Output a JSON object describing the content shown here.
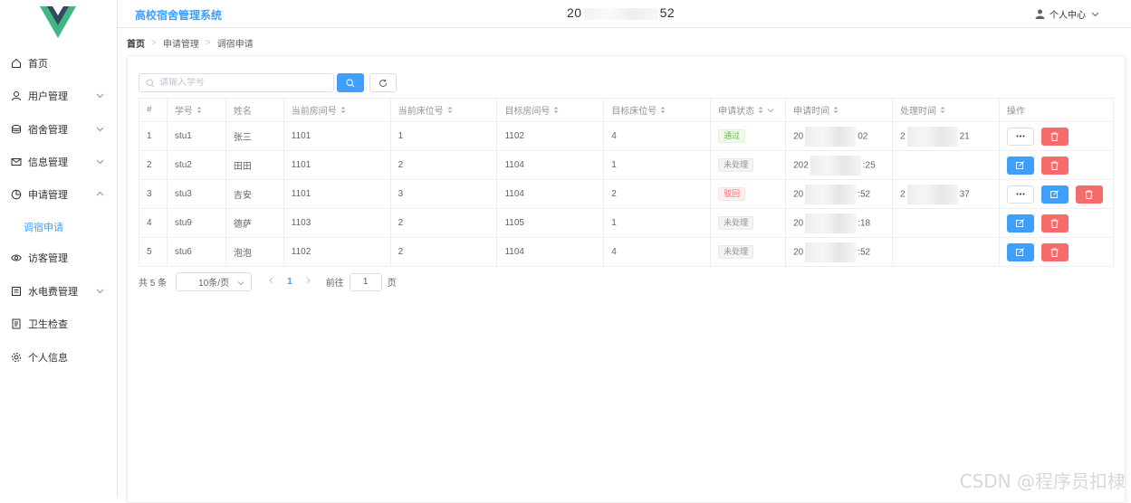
{
  "app": {
    "title": "高校宿舍管理系统"
  },
  "header": {
    "clock_prefix": "20",
    "clock_suffix": "52",
    "user_menu_label": "个人中心"
  },
  "sidebar": {
    "items": [
      {
        "label": "首页",
        "icon": "home-icon"
      },
      {
        "label": "用户管理",
        "icon": "user-icon"
      },
      {
        "label": "宿舍管理",
        "icon": "coin-icon"
      },
      {
        "label": "信息管理",
        "icon": "message-icon"
      },
      {
        "label": "申请管理",
        "icon": "pie-chart-icon"
      },
      {
        "label": "调宿申请",
        "icon": ""
      },
      {
        "label": "访客管理",
        "icon": "view-icon"
      },
      {
        "label": "水电费管理",
        "icon": "tickets-icon"
      },
      {
        "label": "卫生检查",
        "icon": "document-icon"
      },
      {
        "label": "个人信息",
        "icon": "setting-icon"
      }
    ]
  },
  "breadcrumb": {
    "home": "首页",
    "level2": "申请管理",
    "level3": "调宿申请"
  },
  "search": {
    "placeholder": "请输入学号",
    "value": ""
  },
  "table": {
    "headers": [
      "#",
      "学号",
      "姓名",
      "当前房间号",
      "当前床位号",
      "目标房间号",
      "目标床位号",
      "申请状态",
      "申请时间",
      "处理时间",
      "操作"
    ],
    "rows": [
      {
        "idx": "1",
        "student_id": "stu1",
        "name": "张三",
        "cur_room": "1101",
        "cur_bed": "1",
        "target_room": "1102",
        "target_bed": "4",
        "status": "通过",
        "status_type": "success",
        "apply_time_prefix": "20",
        "apply_time_suffix": "02",
        "handle_time_prefix": "2",
        "handle_time_suffix": "21"
      },
      {
        "idx": "2",
        "student_id": "stu2",
        "name": "田田",
        "cur_room": "1101",
        "cur_bed": "2",
        "target_room": "1104",
        "target_bed": "1",
        "status": "未处理",
        "status_type": "info",
        "apply_time_prefix": "202",
        "apply_time_suffix": ":25",
        "handle_time_prefix": "",
        "handle_time_suffix": ""
      },
      {
        "idx": "3",
        "student_id": "stu3",
        "name": "吉安",
        "cur_room": "1101",
        "cur_bed": "3",
        "target_room": "1104",
        "target_bed": "2",
        "status": "驳回",
        "status_type": "danger",
        "apply_time_prefix": "20",
        "apply_time_suffix": ":52",
        "handle_time_prefix": "2",
        "handle_time_suffix": "37"
      },
      {
        "idx": "4",
        "student_id": "stu9",
        "name": "德萨",
        "cur_room": "1103",
        "cur_bed": "2",
        "target_room": "1105",
        "target_bed": "1",
        "status": "未处理",
        "status_type": "info",
        "apply_time_prefix": "20",
        "apply_time_suffix": ":18",
        "handle_time_prefix": "",
        "handle_time_suffix": ""
      },
      {
        "idx": "5",
        "student_id": "stu6",
        "name": "泡泡",
        "cur_room": "1102",
        "cur_bed": "2",
        "target_room": "1104",
        "target_bed": "4",
        "status": "未处理",
        "status_type": "info",
        "apply_time_prefix": "20",
        "apply_time_suffix": ":52",
        "handle_time_prefix": "",
        "handle_time_suffix": ""
      }
    ]
  },
  "pagination": {
    "total_label": "共 5 条",
    "page_size": "10条/页",
    "current_page": "1",
    "goto_label": "前往",
    "goto_value": "1",
    "page_unit": "页"
  },
  "colors": {
    "primary": "#409eff",
    "danger": "#f56c6c",
    "success": "#67c23a",
    "logo_green": "#41b883",
    "logo_dark": "#34495e"
  },
  "watermark": "CSDN @程序员扣棣"
}
